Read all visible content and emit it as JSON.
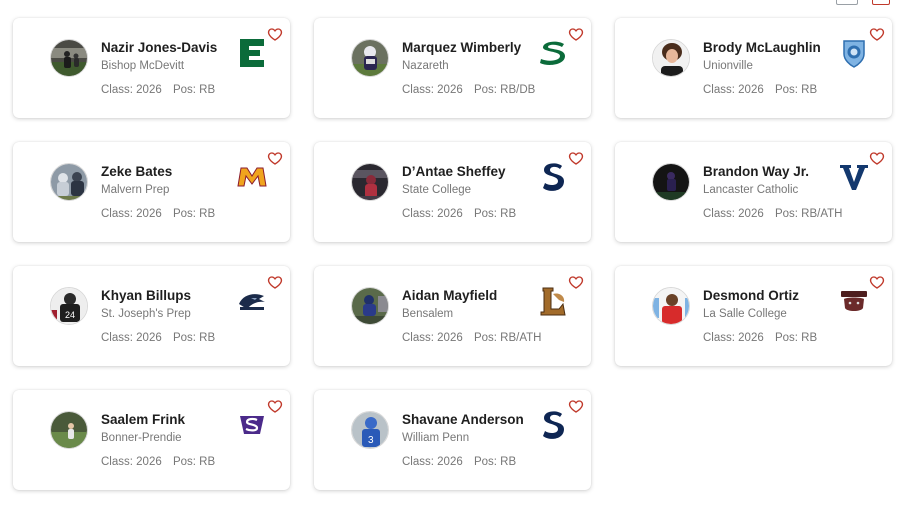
{
  "labels": {
    "class_prefix": "Class: ",
    "pos_prefix": "Pos: "
  },
  "colors": {
    "favorite": "#c0392b",
    "card_shadow": "#d0d0d0"
  },
  "cards": [
    {
      "name": "Nazir Jones-Davis",
      "school": "Bishop McDevitt",
      "class_year": "2026",
      "position": "RB",
      "logo": "eastern-michigan-e-logo"
    },
    {
      "name": "Marquez Wimberly",
      "school": "Nazareth",
      "class_year": "2026",
      "position": "RB/DB",
      "logo": "sacramento-state-s-logo"
    },
    {
      "name": "Brody McLaughlin",
      "school": "Unionville",
      "class_year": "2026",
      "position": "RB",
      "logo": "columbia-lion-logo"
    },
    {
      "name": "Zeke Bates",
      "school": "Malvern Prep",
      "class_year": "2026",
      "position": "RB",
      "logo": "minnesota-m-logo"
    },
    {
      "name": "D’Antae Sheffey",
      "school": "State College",
      "class_year": "2026",
      "position": "RB",
      "logo": "penn-state-s-logo"
    },
    {
      "name": "Brandon Way Jr.",
      "school": "Lancaster Catholic",
      "class_year": "2026",
      "position": "RB/ATH",
      "logo": "villanova-v-logo"
    },
    {
      "name": "Khyan Billups",
      "school": "St. Joseph's Prep",
      "class_year": "2026",
      "position": "RB",
      "logo": "monmouth-hawk-logo"
    },
    {
      "name": "Aidan Mayfield",
      "school": "Bensalem",
      "class_year": "2026",
      "position": "RB/ATH",
      "logo": "lehigh-l-logo"
    },
    {
      "name": "Desmond Ortiz",
      "school": "La Salle College",
      "class_year": "2026",
      "position": "RB",
      "logo": "brown-bear-logo"
    },
    {
      "name": "Saalem Frink",
      "school": "Bonner-Prendie",
      "class_year": "2026",
      "position": "RB",
      "logo": "stonehill-s-logo"
    },
    {
      "name": "Shavane Anderson",
      "school": "William Penn",
      "class_year": "2026",
      "position": "RB",
      "logo": "penn-state-s-logo"
    }
  ]
}
